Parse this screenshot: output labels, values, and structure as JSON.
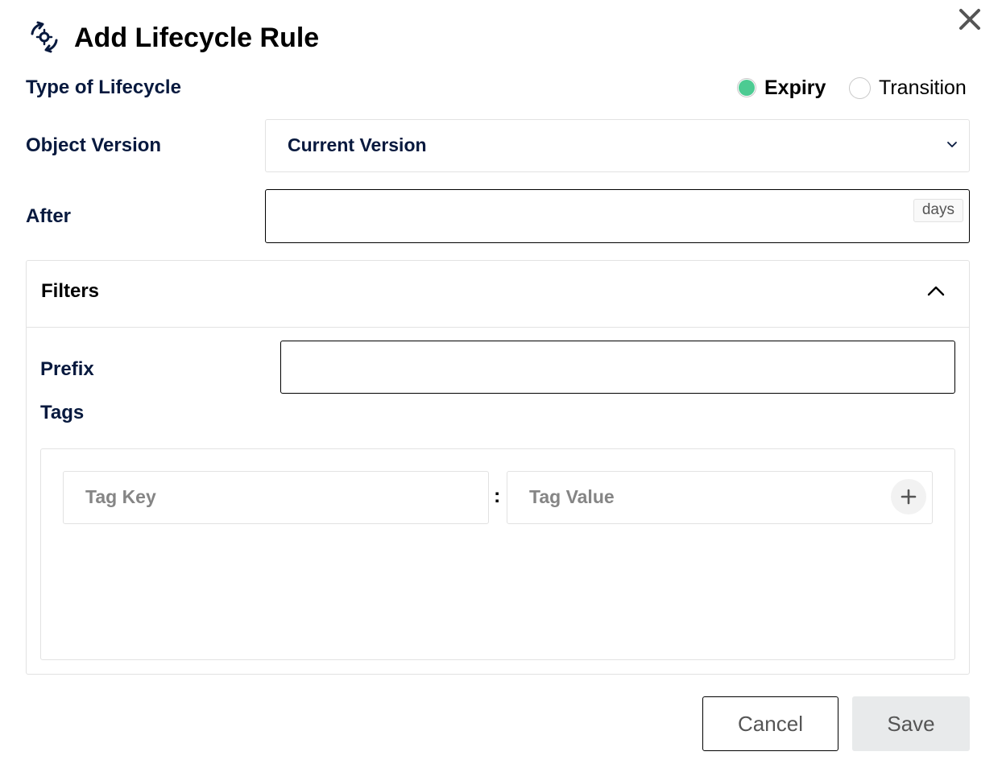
{
  "dialog": {
    "title": "Add Lifecycle Rule",
    "title_icon": "lifecycle-rotate-gear-icon",
    "close_icon": "close-icon"
  },
  "lifecycle_type": {
    "label": "Type of Lifecycle",
    "options": [
      {
        "label": "Expiry",
        "selected": true
      },
      {
        "label": "Transition",
        "selected": false
      }
    ]
  },
  "object_version": {
    "label": "Object Version",
    "selected": "Current Version"
  },
  "after": {
    "label": "After",
    "value": "",
    "unit": "days"
  },
  "filters": {
    "title": "Filters",
    "expanded": true,
    "prefix": {
      "label": "Prefix",
      "value": ""
    },
    "tags": {
      "label": "Tags",
      "key_placeholder": "Tag Key",
      "separator": ":",
      "value_placeholder": "Tag Value",
      "add_icon": "plus-icon"
    }
  },
  "buttons": {
    "cancel": "Cancel",
    "save": "Save"
  },
  "colors": {
    "radio_selected": "#4ccb92",
    "label_text": "#07193e",
    "border": "#e2e2e2",
    "save_bg": "#e8eaeb"
  }
}
